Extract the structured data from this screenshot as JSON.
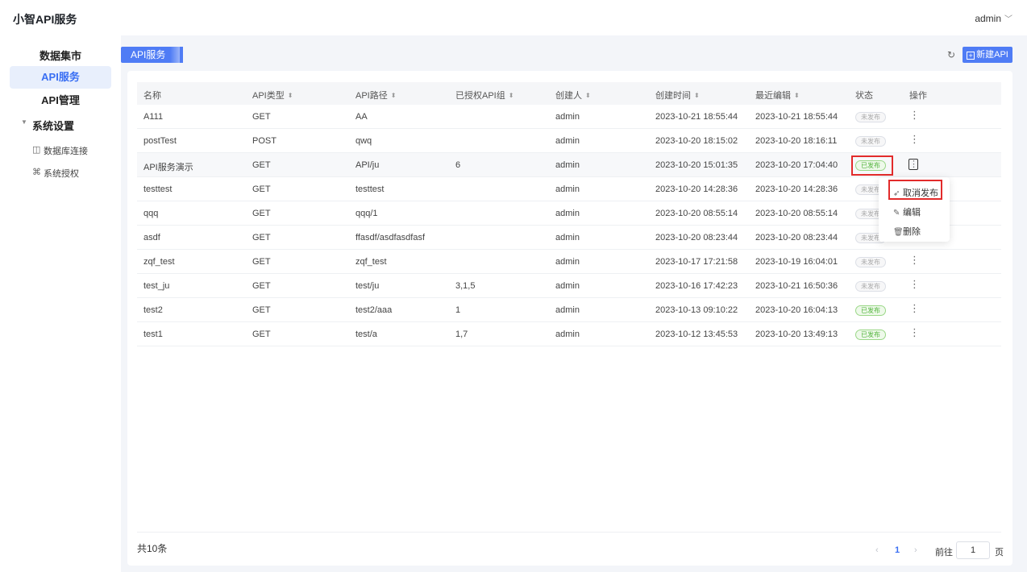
{
  "header": {
    "app_title": "小智API服务",
    "user_name": "admin"
  },
  "sidebar": {
    "items": [
      {
        "label": "数据集市"
      },
      {
        "label": "API服务"
      },
      {
        "label": "API管理"
      }
    ],
    "group": {
      "label": "系统设置"
    },
    "subitems": [
      {
        "label": "数据库连接"
      },
      {
        "label": "系统授权"
      }
    ]
  },
  "tab": {
    "label": "API服务"
  },
  "toolbar": {
    "new_label": "新建API"
  },
  "table": {
    "columns": [
      "名称",
      "API类型",
      "API路径",
      "已授权API组",
      "创建人",
      "创建时间",
      "最近编辑",
      "状态",
      "操作"
    ],
    "rows": [
      {
        "name": "A111",
        "type": "GET",
        "path": "AA",
        "groups": "",
        "creator": "admin",
        "created": "2023-10-21 18:55:44",
        "edited": "2023-10-21 18:55:44",
        "status": "未发布",
        "more": "⋮"
      },
      {
        "name": "postTest",
        "type": "POST",
        "path": "qwq",
        "groups": "",
        "creator": "admin",
        "created": "2023-10-20 18:15:02",
        "edited": "2023-10-20 18:16:11",
        "status": "未发布",
        "more": "⋮"
      },
      {
        "name": "API服务演示",
        "type": "GET",
        "path": "API/ju",
        "groups": "6",
        "creator": "admin",
        "created": "2023-10-20 15:01:35",
        "edited": "2023-10-20 17:04:40",
        "status": "已发布",
        "more": "⋮"
      },
      {
        "name": "testtest",
        "type": "GET",
        "path": "testtest",
        "groups": "",
        "creator": "admin",
        "created": "2023-10-20 14:28:36",
        "edited": "2023-10-20 14:28:36",
        "status": "未发布",
        "more": "⋮"
      },
      {
        "name": "qqq",
        "type": "GET",
        "path": "qqq/1",
        "groups": "",
        "creator": "admin",
        "created": "2023-10-20 08:55:14",
        "edited": "2023-10-20 08:55:14",
        "status": "未发布",
        "more": "⋮"
      },
      {
        "name": "asdf",
        "type": "GET",
        "path": "ffasdf/asdfasdfasf",
        "groups": "",
        "creator": "admin",
        "created": "2023-10-20 08:23:44",
        "edited": "2023-10-20 08:23:44",
        "status": "未发布",
        "more": "⋮"
      },
      {
        "name": "zqf_test",
        "type": "GET",
        "path": "zqf_test",
        "groups": "",
        "creator": "admin",
        "created": "2023-10-17 17:21:58",
        "edited": "2023-10-19 16:04:01",
        "status": "未发布",
        "more": "⋮"
      },
      {
        "name": "test_ju",
        "type": "GET",
        "path": "test/ju",
        "groups": "3,1,5",
        "creator": "admin",
        "created": "2023-10-16 17:42:23",
        "edited": "2023-10-21 16:50:36",
        "status": "未发布",
        "more": "⋮"
      },
      {
        "name": "test2",
        "type": "GET",
        "path": "test2/aaa",
        "groups": "1",
        "creator": "admin",
        "created": "2023-10-13 09:10:22",
        "edited": "2023-10-20 16:04:13",
        "status": "已发布",
        "more": "⋮"
      },
      {
        "name": "test1",
        "type": "GET",
        "path": "test/a",
        "groups": "1,7",
        "creator": "admin",
        "created": "2023-10-12 13:45:53",
        "edited": "2023-10-20 13:49:13",
        "status": "已发布",
        "more": "⋮"
      }
    ]
  },
  "menu": {
    "items": [
      {
        "label": "取消发布",
        "icon": "send-icon"
      },
      {
        "label": "编辑",
        "icon": "edit-icon"
      },
      {
        "label": "删除",
        "icon": "trash-icon"
      }
    ]
  },
  "footer": {
    "total": "共10条",
    "current_page": "1",
    "goto_label": "前往",
    "goto_value": "1",
    "page_suffix": "页"
  },
  "colors": {
    "accent": "#4f7cf5",
    "published": "#52b43c",
    "highlight": "#e22b2b"
  }
}
